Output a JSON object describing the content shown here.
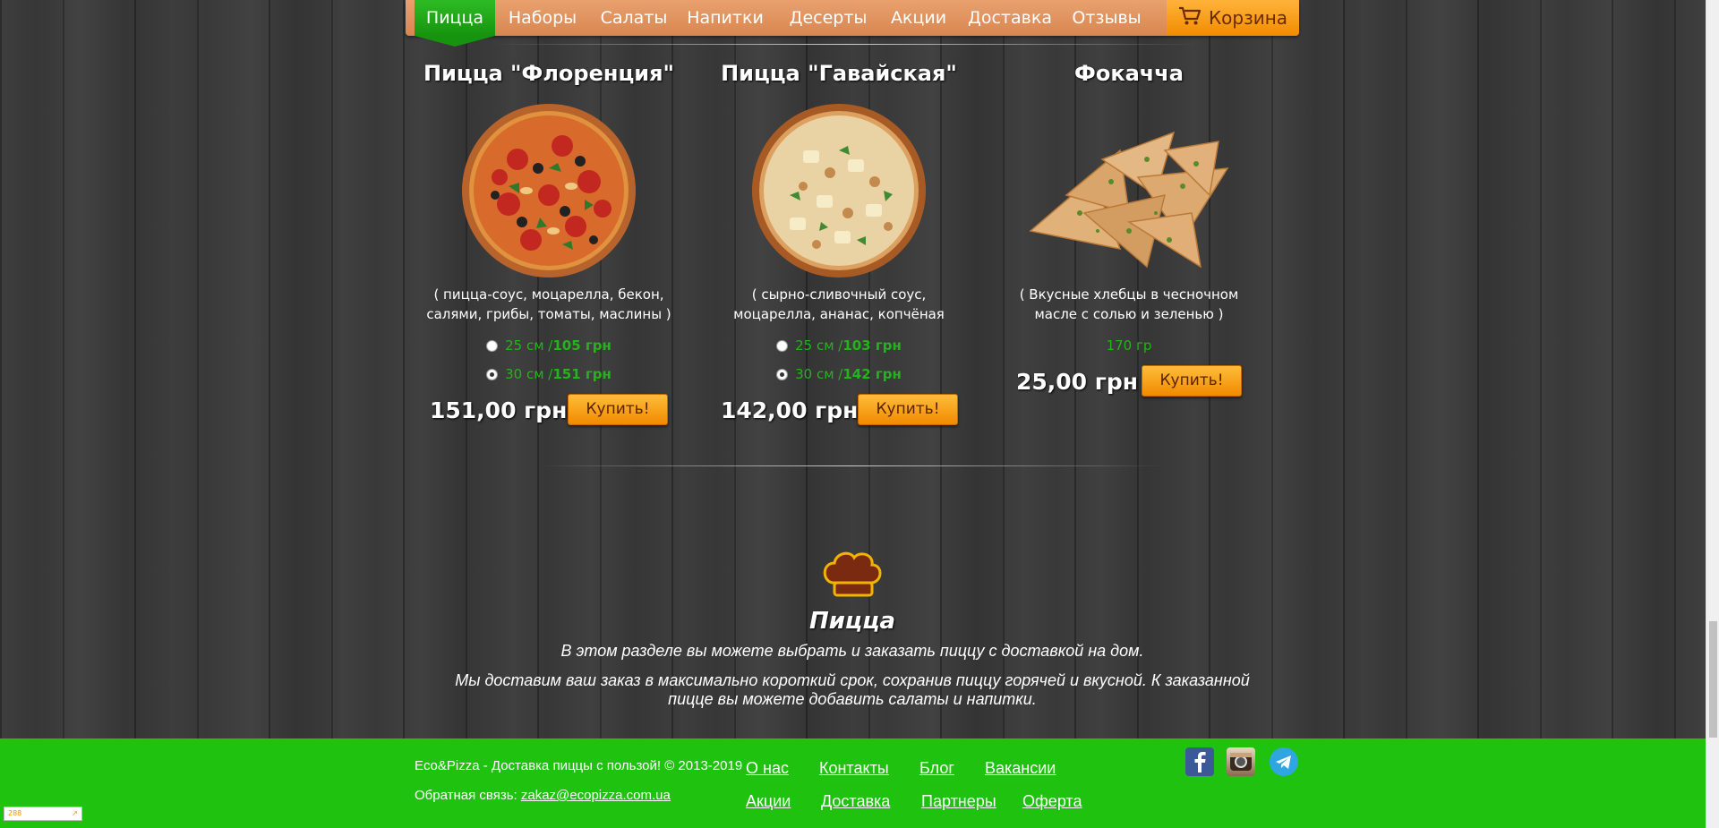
{
  "nav": {
    "items": [
      {
        "label": "Пицца",
        "active": true
      },
      {
        "label": "Наборы"
      },
      {
        "label": "Салаты"
      },
      {
        "label": "Напитки"
      },
      {
        "label": "Десерты"
      },
      {
        "label": "Акции"
      },
      {
        "label": "Доставка"
      },
      {
        "label": "Отзывы"
      }
    ],
    "cart_label": "Корзина"
  },
  "products": [
    {
      "title": "Пицца \"Флоренция\"",
      "description": "( пицца-соус, моцарелла, бекон, салями, грибы, томаты, маслины )",
      "options": [
        {
          "size": "25 см / ",
          "price": "105 грн",
          "checked": false
        },
        {
          "size": "30 см / ",
          "price": "151 грн",
          "checked": true
        }
      ],
      "price": "151,00 грн",
      "buy_label": "Купить!"
    },
    {
      "title": "Пицца \"Гавайская\"",
      "description": "( сырно-сливочный соус, моцарелла, ананас, копчёная курица, кунжут,",
      "options": [
        {
          "size": "25 см / ",
          "price": "103 грн",
          "checked": false
        },
        {
          "size": "30 см / ",
          "price": "142 грн",
          "checked": true
        }
      ],
      "price": "142,00 грн",
      "buy_label": "Купить!"
    },
    {
      "title": "Фокачча",
      "description": "( Вкусные хлебцы в чесночном масле с солью и зеленью )",
      "weight": "170 гр",
      "price": "25,00 грн",
      "buy_label": "Купить!"
    }
  ],
  "info": {
    "title": "Пицца",
    "text1": "В этом разделе вы можете выбрать и заказать пиццу с доставкой на дом.",
    "text2": "Мы доставим ваш заказ в максимально короткий срок, сохранив пиццу горячей и вкусной. К заказанной пицце вы можете добавить салаты и напитки."
  },
  "footer": {
    "copyright": "Eco&Pizza - Доставка пиццы с пользой! © 2013-2019",
    "feedback_label": "Обратная связь: ",
    "feedback_email": "zakaz@ecopizza.com.ua",
    "links_row1": [
      "О нас",
      "Контакты",
      "Блог",
      "Вакансии"
    ],
    "links_row2": [
      "Акции",
      "Доставка",
      "Партнеры",
      "Оферта"
    ],
    "social": [
      "facebook-icon",
      "instagram-icon",
      "telegram-icon"
    ]
  },
  "counter_text": "288",
  "colors": {
    "accent_green": "#1fc20f",
    "orange": "#f28c00",
    "nav_bg": "#d88650",
    "option_green": "#23b41a"
  }
}
